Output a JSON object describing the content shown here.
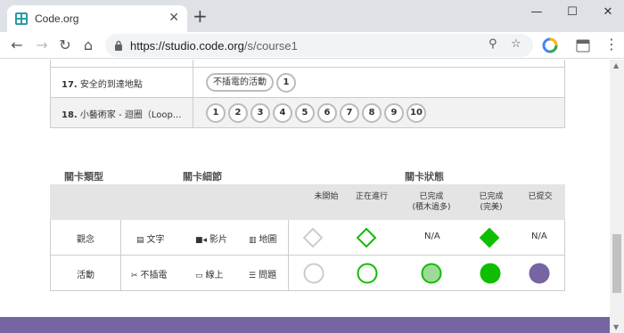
{
  "browser": {
    "tab_title": "Code.org",
    "tab_close": "✕",
    "new_tab": "+",
    "url_host": "https://studio.code.org",
    "url_path": "/s/course1",
    "window_controls": {
      "minimize": "—",
      "maximize": "☐",
      "close": "✕"
    }
  },
  "lessons": [
    {
      "number": "17.",
      "name": "安全的到達地點",
      "pill": "不插電的活動",
      "bubbles": [
        "1"
      ]
    },
    {
      "number": "18.",
      "name": "小藝術家 - 迴圈（Loop...",
      "bubbles": [
        "1",
        "2",
        "3",
        "4",
        "5",
        "6",
        "7",
        "8",
        "9",
        "10"
      ]
    }
  ],
  "key": {
    "heading_type": "關卡類型",
    "heading_details": "關卡細節",
    "heading_status": "關卡狀態",
    "status_columns": [
      "未開始",
      "正在進行",
      "已完成\n(積木過多)",
      "已完成\n(完美)",
      "已提交"
    ],
    "rows": [
      {
        "label": "觀念",
        "details": [
          {
            "icon": "document-icon",
            "text": "文字"
          },
          {
            "icon": "video-icon",
            "text": "影片"
          },
          {
            "icon": "map-icon",
            "text": "地圖"
          }
        ],
        "na_1": "N/A",
        "na_2": "N/A"
      },
      {
        "label": "活動",
        "details": [
          {
            "icon": "scissors-icon",
            "text": "不插電"
          },
          {
            "icon": "desktop-icon",
            "text": "線上"
          },
          {
            "icon": "list-icon",
            "text": "問題"
          }
        ]
      }
    ],
    "colors": {
      "not_started": "#cccccc",
      "in_progress": "#0fbe00",
      "completed_too_many": "#9fd99a",
      "completed_perfect": "#0fbe00",
      "submitted": "#7665a0"
    }
  },
  "theme": {
    "footer": "#7665a0"
  }
}
